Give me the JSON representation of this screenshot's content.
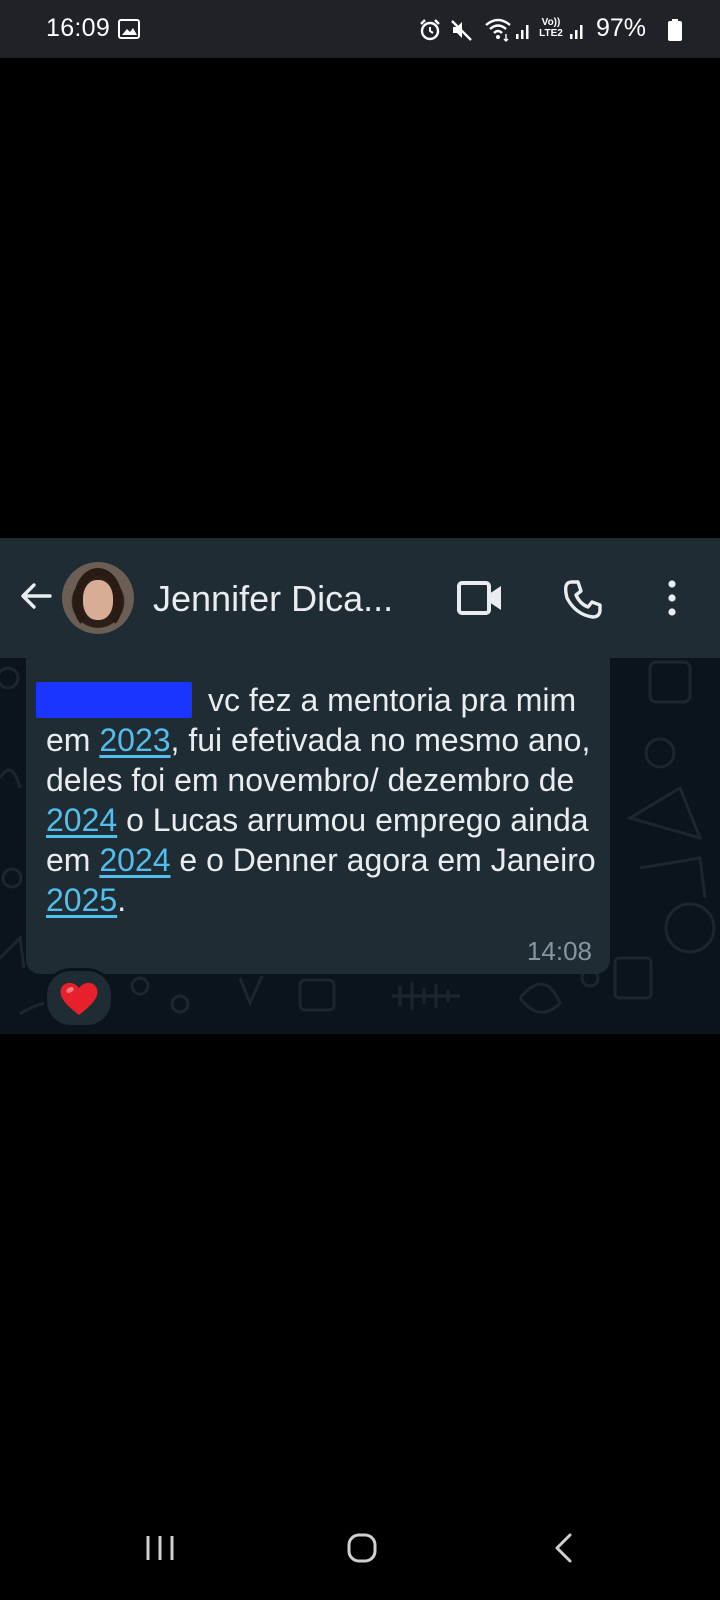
{
  "status_bar": {
    "time": "16:09",
    "volte_line1": "Vo))",
    "volte_line2": "LTE2",
    "battery_percent": "97%",
    "icons": [
      "gallery-icon",
      "alarm-icon",
      "mute-icon",
      "wifi-icon",
      "signal-icon",
      "battery-icon"
    ]
  },
  "header": {
    "contact_name": "Jennifer Dica...",
    "icons": [
      "back-arrow-icon",
      "video-call-icon",
      "phone-icon",
      "more-options-icon"
    ]
  },
  "message": {
    "segments": [
      {
        "text": "vc fez a mentoria pra mim em ",
        "link": false
      },
      {
        "text": "2023",
        "link": true
      },
      {
        "text": ", fui efetivada no mesmo ano, deles foi em novembro/ dezembro de ",
        "link": false
      },
      {
        "text": "2024",
        "link": true
      },
      {
        "text": " o Lucas arrumou emprego ainda em ",
        "link": false
      },
      {
        "text": "2024",
        "link": true
      },
      {
        "text": " e o Denner agora em Janeiro ",
        "link": false
      },
      {
        "text": "2025",
        "link": true
      },
      {
        "text": ".",
        "link": false
      }
    ],
    "time": "14:08",
    "reaction": "heart"
  },
  "colors": {
    "header_bg": "#1f2c33",
    "chat_bg": "#0b141a",
    "bubble_bg": "#1f2c34",
    "link": "#53bdeb",
    "timestamp": "#8696a0",
    "redaction": "#1a35ff"
  },
  "nav_bar": {
    "icons": [
      "recents-icon",
      "home-icon",
      "back-icon"
    ]
  }
}
